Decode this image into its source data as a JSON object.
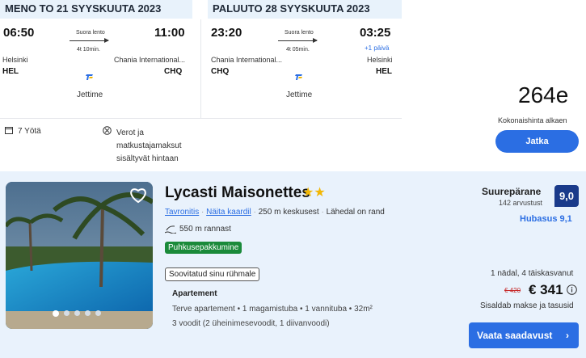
{
  "outbound": {
    "header": "MENO TO 21 SYYSKUUTA 2023",
    "dep_time": "06:50",
    "arr_time": "11:00",
    "direct": "Suora lento",
    "duration": "4t 10min.",
    "dep_city": "Helsinki",
    "arr_city": "Chania International...",
    "dep_code": "HEL",
    "arr_code": "CHQ",
    "airline": "Jettime"
  },
  "return": {
    "header": "PALUUTO 28 SYYSKUUTA 2023",
    "dep_time": "23:20",
    "arr_time": "03:25",
    "direct": "Suora lento",
    "duration": "4t 05min.",
    "next_day": "+1 päivä",
    "dep_city": "Chania International...",
    "arr_city": "Helsinki",
    "dep_code": "CHQ",
    "arr_code": "HEL",
    "airline": "Jettime"
  },
  "nights": "7 Yötä",
  "taxes": [
    "Verot ja",
    "matkustajamaksut",
    "sisältyvät hintaan"
  ],
  "price": {
    "amount": "264e",
    "label": "Kokonaishinta alkaen",
    "button": "Jatka"
  },
  "hotel": {
    "name": "Lycasti Maisonettes",
    "stars": "★★",
    "location": "Tavronitis",
    "map_link": "Näita kaardil",
    "distance_center": "250 m keskusest",
    "beach_near": "Lähedal on rand",
    "beach_distance": "550 m rannast",
    "tag_green": "Puhkusepakkumine",
    "tag_group": "Soovitatud sinu rühmale",
    "room_type": "Apartement",
    "room_desc": "Terve apartement • 1 magamistuba • 1 vannituba • 32m²",
    "beds": "3 voodit (2 üheinimesevoodit, 1 diivanvoodi)",
    "rating_word": "Suurepärane",
    "reviews": "142 arvustust",
    "rating_score": "9,0",
    "cleanliness": "Hubasus 9,1",
    "stay_info": "1 nädal, 4 täiskasvanut",
    "old_price": "€ 420",
    "new_price": "€ 341",
    "price_note": "Sisaldab makse ja tasusid",
    "cta": "Vaata saadavust"
  },
  "colors": {
    "accent": "#2b6ee3",
    "header_bg": "#e8f2fb",
    "hotel_bg": "#e9f2fc",
    "green": "#1a8a3a",
    "score_bg": "#1a3a8a"
  }
}
